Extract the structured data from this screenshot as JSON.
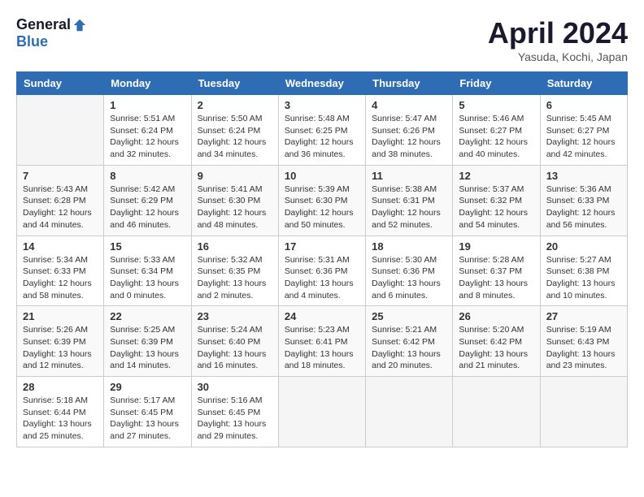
{
  "logo": {
    "general": "General",
    "blue": "Blue"
  },
  "title": "April 2024",
  "location": "Yasuda, Kochi, Japan",
  "weekdays": [
    "Sunday",
    "Monday",
    "Tuesday",
    "Wednesday",
    "Thursday",
    "Friday",
    "Saturday"
  ],
  "weeks": [
    [
      {
        "day": "",
        "info": ""
      },
      {
        "day": "1",
        "info": "Sunrise: 5:51 AM\nSunset: 6:24 PM\nDaylight: 12 hours\nand 32 minutes."
      },
      {
        "day": "2",
        "info": "Sunrise: 5:50 AM\nSunset: 6:24 PM\nDaylight: 12 hours\nand 34 minutes."
      },
      {
        "day": "3",
        "info": "Sunrise: 5:48 AM\nSunset: 6:25 PM\nDaylight: 12 hours\nand 36 minutes."
      },
      {
        "day": "4",
        "info": "Sunrise: 5:47 AM\nSunset: 6:26 PM\nDaylight: 12 hours\nand 38 minutes."
      },
      {
        "day": "5",
        "info": "Sunrise: 5:46 AM\nSunset: 6:27 PM\nDaylight: 12 hours\nand 40 minutes."
      },
      {
        "day": "6",
        "info": "Sunrise: 5:45 AM\nSunset: 6:27 PM\nDaylight: 12 hours\nand 42 minutes."
      }
    ],
    [
      {
        "day": "7",
        "info": "Sunrise: 5:43 AM\nSunset: 6:28 PM\nDaylight: 12 hours\nand 44 minutes."
      },
      {
        "day": "8",
        "info": "Sunrise: 5:42 AM\nSunset: 6:29 PM\nDaylight: 12 hours\nand 46 minutes."
      },
      {
        "day": "9",
        "info": "Sunrise: 5:41 AM\nSunset: 6:30 PM\nDaylight: 12 hours\nand 48 minutes."
      },
      {
        "day": "10",
        "info": "Sunrise: 5:39 AM\nSunset: 6:30 PM\nDaylight: 12 hours\nand 50 minutes."
      },
      {
        "day": "11",
        "info": "Sunrise: 5:38 AM\nSunset: 6:31 PM\nDaylight: 12 hours\nand 52 minutes."
      },
      {
        "day": "12",
        "info": "Sunrise: 5:37 AM\nSunset: 6:32 PM\nDaylight: 12 hours\nand 54 minutes."
      },
      {
        "day": "13",
        "info": "Sunrise: 5:36 AM\nSunset: 6:33 PM\nDaylight: 12 hours\nand 56 minutes."
      }
    ],
    [
      {
        "day": "14",
        "info": "Sunrise: 5:34 AM\nSunset: 6:33 PM\nDaylight: 12 hours\nand 58 minutes."
      },
      {
        "day": "15",
        "info": "Sunrise: 5:33 AM\nSunset: 6:34 PM\nDaylight: 13 hours\nand 0 minutes."
      },
      {
        "day": "16",
        "info": "Sunrise: 5:32 AM\nSunset: 6:35 PM\nDaylight: 13 hours\nand 2 minutes."
      },
      {
        "day": "17",
        "info": "Sunrise: 5:31 AM\nSunset: 6:36 PM\nDaylight: 13 hours\nand 4 minutes."
      },
      {
        "day": "18",
        "info": "Sunrise: 5:30 AM\nSunset: 6:36 PM\nDaylight: 13 hours\nand 6 minutes."
      },
      {
        "day": "19",
        "info": "Sunrise: 5:28 AM\nSunset: 6:37 PM\nDaylight: 13 hours\nand 8 minutes."
      },
      {
        "day": "20",
        "info": "Sunrise: 5:27 AM\nSunset: 6:38 PM\nDaylight: 13 hours\nand 10 minutes."
      }
    ],
    [
      {
        "day": "21",
        "info": "Sunrise: 5:26 AM\nSunset: 6:39 PM\nDaylight: 13 hours\nand 12 minutes."
      },
      {
        "day": "22",
        "info": "Sunrise: 5:25 AM\nSunset: 6:39 PM\nDaylight: 13 hours\nand 14 minutes."
      },
      {
        "day": "23",
        "info": "Sunrise: 5:24 AM\nSunset: 6:40 PM\nDaylight: 13 hours\nand 16 minutes."
      },
      {
        "day": "24",
        "info": "Sunrise: 5:23 AM\nSunset: 6:41 PM\nDaylight: 13 hours\nand 18 minutes."
      },
      {
        "day": "25",
        "info": "Sunrise: 5:21 AM\nSunset: 6:42 PM\nDaylight: 13 hours\nand 20 minutes."
      },
      {
        "day": "26",
        "info": "Sunrise: 5:20 AM\nSunset: 6:42 PM\nDaylight: 13 hours\nand 21 minutes."
      },
      {
        "day": "27",
        "info": "Sunrise: 5:19 AM\nSunset: 6:43 PM\nDaylight: 13 hours\nand 23 minutes."
      }
    ],
    [
      {
        "day": "28",
        "info": "Sunrise: 5:18 AM\nSunset: 6:44 PM\nDaylight: 13 hours\nand 25 minutes."
      },
      {
        "day": "29",
        "info": "Sunrise: 5:17 AM\nSunset: 6:45 PM\nDaylight: 13 hours\nand 27 minutes."
      },
      {
        "day": "30",
        "info": "Sunrise: 5:16 AM\nSunset: 6:45 PM\nDaylight: 13 hours\nand 29 minutes."
      },
      {
        "day": "",
        "info": ""
      },
      {
        "day": "",
        "info": ""
      },
      {
        "day": "",
        "info": ""
      },
      {
        "day": "",
        "info": ""
      }
    ]
  ]
}
